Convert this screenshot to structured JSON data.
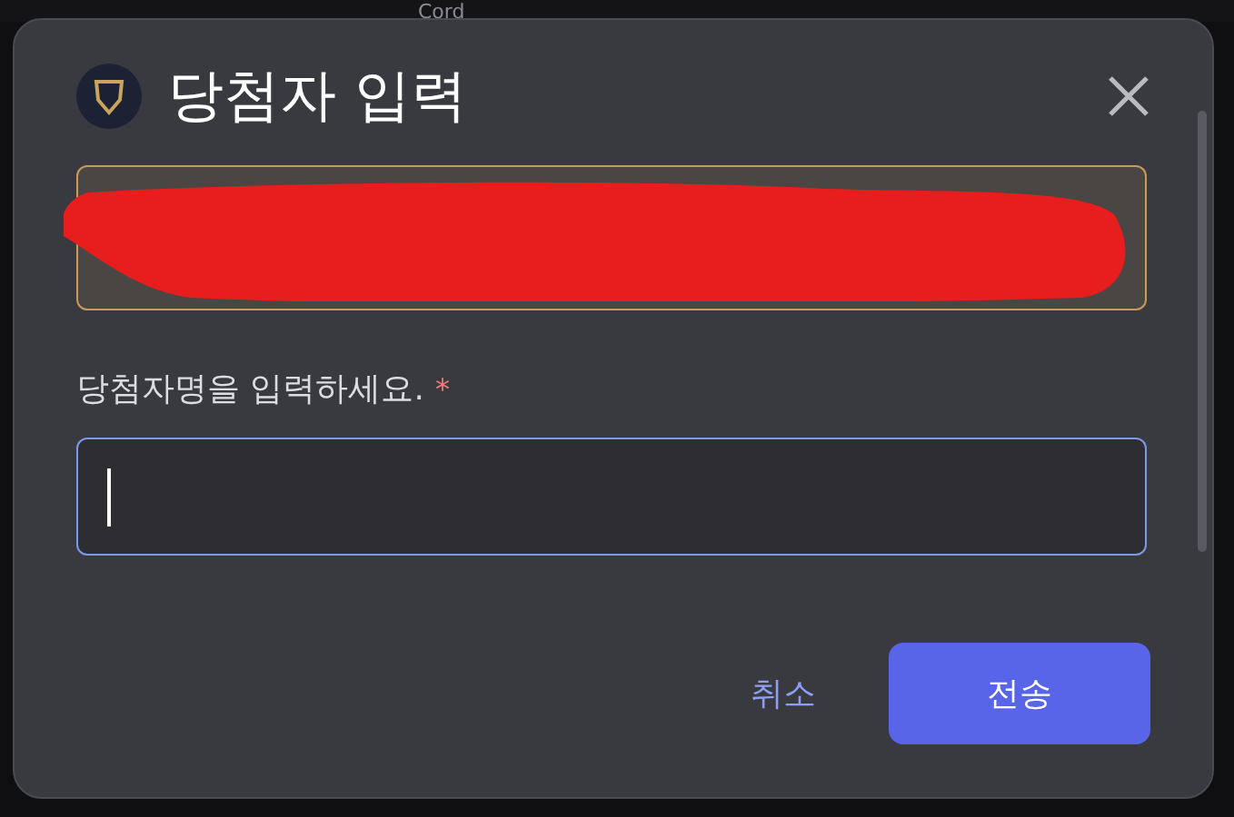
{
  "background_table": {
    "columns": [
      "Cord"
    ]
  },
  "dialog": {
    "title": "당첨자 입력",
    "info_box": {
      "redacted": true
    },
    "field": {
      "label": "당첨자명을 입력하세요.",
      "required_mark": "*",
      "focused": true
    },
    "buttons": [
      {
        "label": "취소",
        "kind": "text"
      },
      {
        "label": "전송",
        "kind": "primary"
      }
    ]
  }
}
